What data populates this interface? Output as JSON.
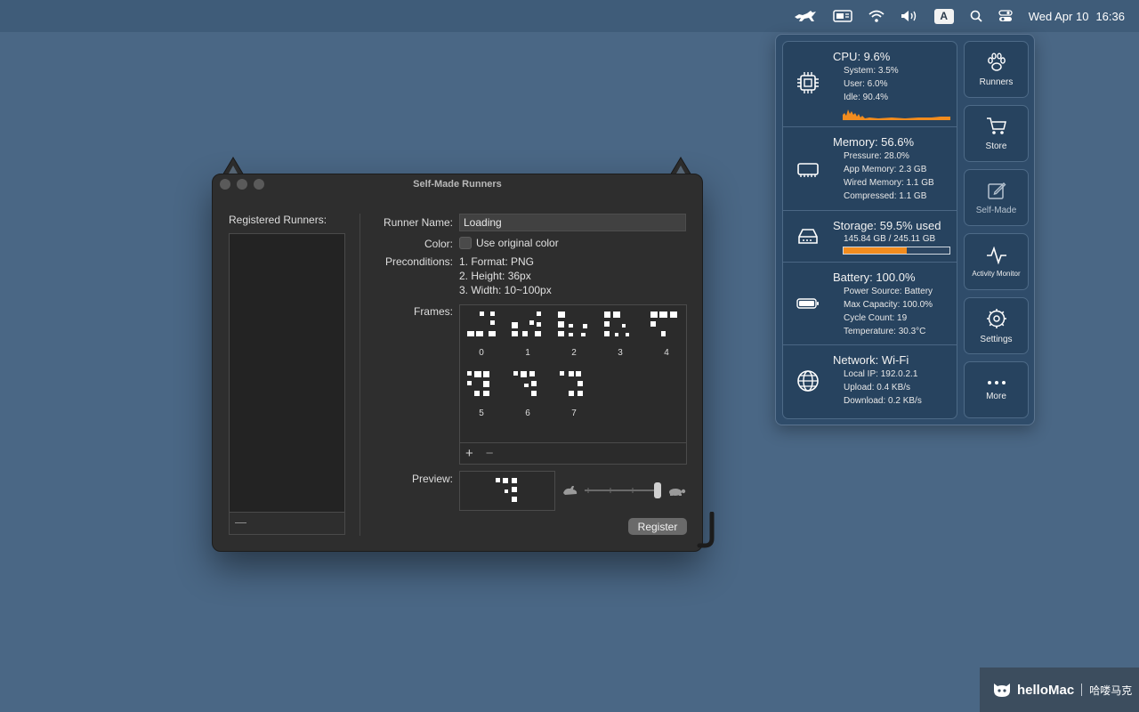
{
  "menubar": {
    "icons": [
      "runcat-icon",
      "display-icon",
      "wifi-icon",
      "volume-icon",
      "input-source-icon",
      "spotlight-icon",
      "control-center-icon"
    ],
    "input_source": "A",
    "date": "Wed Apr 10",
    "time": "16:36"
  },
  "stats": {
    "cpu": {
      "title": "CPU:  9.6%",
      "system": "System:  3.5%",
      "user": "User:  6.0%",
      "idle": "Idle:  90.4%",
      "graph_color": "#f28c1e"
    },
    "memory": {
      "title": "Memory: 56.6%",
      "pressure": "Pressure: 28.0%",
      "app": "App Memory:  2.3 GB",
      "wired": "Wired Memory:  1.1 GB",
      "compressed": "Compressed:  1.1 GB"
    },
    "storage": {
      "title": "Storage: 59.5% used",
      "detail": "145.84 GB / 245.11 GB",
      "used_fraction": 0.595,
      "bar_color": "#f28c1e"
    },
    "battery": {
      "title": "Battery: 100.0%",
      "source": "Power Source: Battery",
      "max_capacity": "Max Capacity: 100.0%",
      "cycle": "Cycle Count: 19",
      "temperature": "Temperature: 30.3°C"
    },
    "network": {
      "title": "Network: Wi-Fi",
      "local_ip": "Local IP: 192.0.2.1",
      "upload": "Upload:   0.4 KB/s",
      "download": "Download:   0.2 KB/s"
    }
  },
  "side_buttons": {
    "runners": "Runners",
    "store": "Store",
    "self_made": "Self-Made",
    "activity_monitor": "Activity Monitor",
    "settings": "Settings",
    "more": "More"
  },
  "window": {
    "title": "Self-Made Runners",
    "registered_label": "Registered Runners:",
    "registered_remove": "—",
    "runner_name_label": "Runner Name:",
    "runner_name_value": "Loading",
    "color_label": "Color:",
    "color_checkbox_label": "Use original color",
    "color_checked": false,
    "preconditions_label": "Preconditions:",
    "preconditions": [
      "1. Format: PNG",
      "2. Height: 36px",
      "3. Width: 10~100px"
    ],
    "frames_label": "Frames:",
    "frame_numbers": [
      "0",
      "1",
      "2",
      "3",
      "4",
      "5",
      "6",
      "7"
    ],
    "add_frame": "+",
    "remove_frame": "−",
    "preview_label": "Preview:",
    "register_button": "Register"
  },
  "watermark": {
    "brand": "helloMac",
    "cn": "哈喽马克"
  }
}
